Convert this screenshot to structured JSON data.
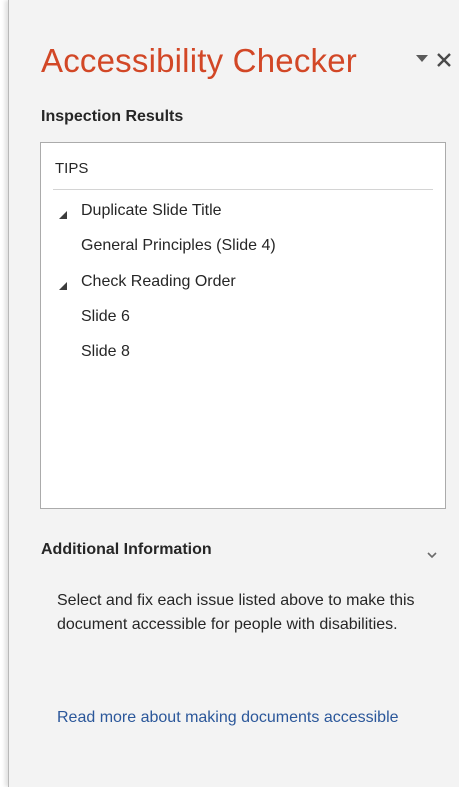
{
  "pane": {
    "title": "Accessibility Checker",
    "accent_color": "#d24726",
    "controls": {
      "dropdown_icon": "caret-down-icon",
      "close_icon": "close-icon"
    }
  },
  "inspection": {
    "heading": "Inspection Results",
    "category": "TIPS",
    "groups": [
      {
        "label": "Duplicate Slide Title",
        "expanded": true,
        "items": [
          "General Principles (Slide 4)"
        ]
      },
      {
        "label": "Check Reading Order",
        "expanded": true,
        "items": [
          "Slide 6",
          "Slide 8"
        ]
      }
    ]
  },
  "additional_info": {
    "heading": "Additional Information",
    "collapse_icon": "chevron-down-icon",
    "body": "Select and fix each issue listed above to make this document accessible for people with disabilities.",
    "link_text": "Read more about making documents accessible",
    "link_color": "#2b579a"
  }
}
